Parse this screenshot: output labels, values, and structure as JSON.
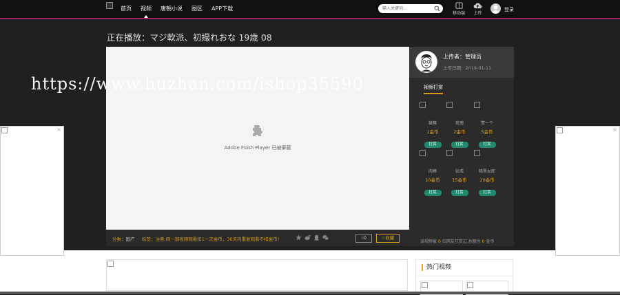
{
  "nav": {
    "items": [
      {
        "label": "首页",
        "active": false
      },
      {
        "label": "视频",
        "active": true
      },
      {
        "label": "唐朝小说",
        "active": false
      },
      {
        "label": "图区",
        "active": false
      },
      {
        "label": "APP下载",
        "active": false
      }
    ]
  },
  "search": {
    "placeholder": "输入关键词..."
  },
  "header_tools": {
    "mobile_label": "移动端",
    "upload_label": "上传",
    "login_label": "登录"
  },
  "video": {
    "title": "正在播放：マジ軟派、初撮れおな 19歳 08"
  },
  "player": {
    "flash_message": "Adobe Flash Player 已被屏蔽"
  },
  "info_bar": {
    "category_label": "分类：",
    "category_value": "国产",
    "tag_text": "标签：注意:同一部视频观看扣1一次金币，30天内重复观看不扣金币！",
    "like_label": "0",
    "favorite_label": "收藏"
  },
  "uploader": {
    "name_label": "上传者：管理员",
    "date_label": "上传日期：2019-01-11"
  },
  "tip_panel": {
    "title": "视频打赏",
    "gifts": [
      {
        "name": "鼓舞",
        "price": "1金币",
        "button": "打赏"
      },
      {
        "name": "玫瑰",
        "price": "2金币",
        "button": "打赏"
      },
      {
        "name": "赞一个",
        "price": "5金币",
        "button": "打赏"
      },
      {
        "name": "肉棒",
        "price": "10金币",
        "button": "打赏"
      },
      {
        "name": "钻戒",
        "price": "15金币",
        "button": "打赏"
      },
      {
        "name": "暗黑女郎",
        "price": "20金币",
        "button": "打赏"
      }
    ],
    "summary_prefix": "该视频被",
    "summary_count": "0",
    "summary_middle": "位网友打赏过,总额为",
    "summary_total": "0",
    "summary_suffix": "金币"
  },
  "watermark": {
    "text": "https://www.huzhan.com/ishop35590"
  },
  "ads": {
    "close_symbol": "×"
  },
  "hot": {
    "title": "热门视频"
  },
  "colors": {
    "accent": "#a3215b",
    "gold": "#d79b1d",
    "green": "#1f8a6e",
    "bg_dark": "#202020"
  }
}
